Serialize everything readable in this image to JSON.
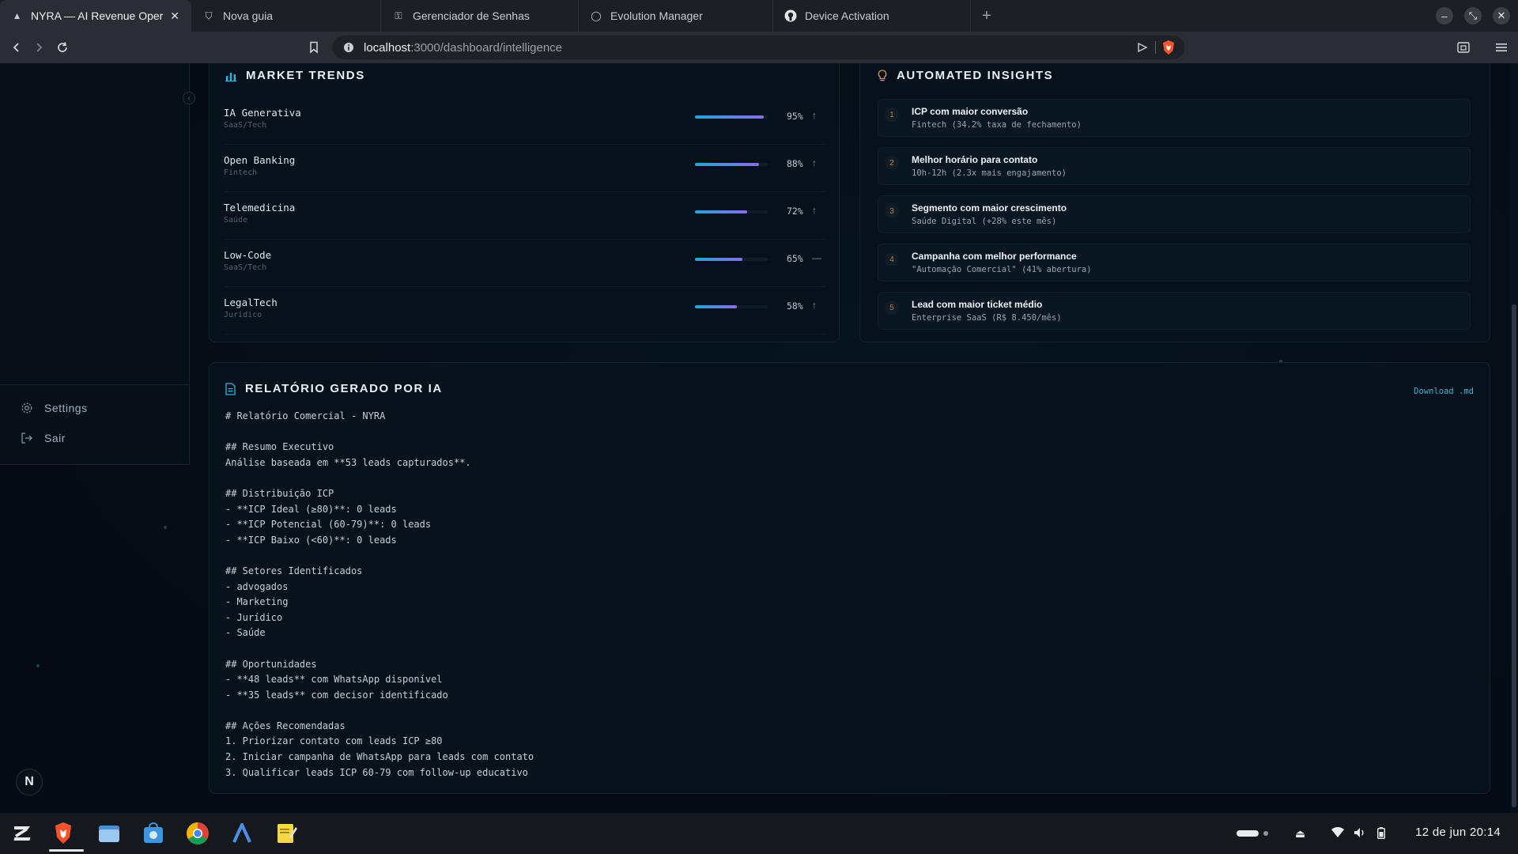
{
  "browser": {
    "tabs": [
      {
        "label": "NYRA — AI Revenue Operat",
        "icon": "nyra-logo-icon",
        "active": true
      },
      {
        "label": "Nova guia",
        "icon": "brave-shield-icon",
        "active": false
      },
      {
        "label": "Gerenciador de Senhas",
        "icon": "key-icon",
        "active": false
      },
      {
        "label": "Evolution Manager",
        "icon": "chat-bubble-icon",
        "active": false
      },
      {
        "label": "Device Activation",
        "icon": "github-icon",
        "active": false
      }
    ],
    "new_tab": "+",
    "url_host": "localhost",
    "url_path": ":3000/dashboard/intelligence",
    "window_controls": {
      "minimize": "–",
      "restore": "⤡",
      "close": "✕"
    }
  },
  "sidebar": {
    "settings_label": "Settings",
    "logout_label": "Sair",
    "avatar_letter": "N"
  },
  "market_trends": {
    "title": "MARKET TRENDS",
    "items": [
      {
        "name": "IA Generativa",
        "sector": "SaaS/Tech",
        "pct_label": "95%",
        "value": 0.95,
        "trend": "↑"
      },
      {
        "name": "Open Banking",
        "sector": "Fintech",
        "pct_label": "88%",
        "value": 0.88,
        "trend": "↑"
      },
      {
        "name": "Telemedicina",
        "sector": "Saúde",
        "pct_label": "72%",
        "value": 0.72,
        "trend": "↑"
      },
      {
        "name": "Low-Code",
        "sector": "SaaS/Tech",
        "pct_label": "65%",
        "value": 0.65,
        "trend": "—"
      },
      {
        "name": "LegalTech",
        "sector": "Jurídico",
        "pct_label": "58%",
        "value": 0.58,
        "trend": "↑"
      }
    ]
  },
  "insights": {
    "title": "AUTOMATED INSIGHTS",
    "items": [
      {
        "num": "1",
        "title": "ICP com maior conversão",
        "desc": "Fintech (34.2% taxa de fechamento)"
      },
      {
        "num": "2",
        "title": "Melhor horário para contato",
        "desc": "10h-12h (2.3x mais engajamento)"
      },
      {
        "num": "3",
        "title": "Segmento com maior crescimento",
        "desc": "Saúde Digital (+28% este mês)"
      },
      {
        "num": "4",
        "title": "Campanha com melhor performance",
        "desc": "\"Automação Comercial\" (41% abertura)"
      },
      {
        "num": "5",
        "title": "Lead com maior ticket médio",
        "desc": "Enterprise SaaS (R$ 8.450/mês)"
      }
    ]
  },
  "report": {
    "title": "RELATÓRIO GERADO POR IA",
    "download_label": "Download .md",
    "lines": [
      "# Relatório Comercial - NYRA",
      "",
      "## Resumo Executivo",
      "Análise baseada em **53 leads capturados**.",
      "",
      "## Distribuição ICP",
      "- **ICP Ideal (≥80)**: 0 leads",
      "- **ICP Potencial (60-79)**: 0 leads",
      "- **ICP Baixo (<60)**: 0 leads",
      "",
      "## Setores Identificados",
      "- advogados",
      "- Marketing",
      "- Jurídico",
      "- Saúde",
      "",
      "## Oportunidades",
      "- **48 leads** com WhatsApp disponível",
      "- **35 leads** com decisor identificado",
      "",
      "## Ações Recomendadas",
      "1. Priorizar contato com leads ICP ≥80",
      "2. Iniciar campanha de WhatsApp para leads com contato",
      "3. Qualificar leads ICP 60-79 com follow-up educativo"
    ]
  },
  "taskbar": {
    "apps": [
      "zorin-menu-icon",
      "brave-browser-icon",
      "files-icon",
      "software-store-icon",
      "chrome-icon",
      "arc-app-icon",
      "notes-icon"
    ],
    "clock": "12 de jun  20:14"
  },
  "colors": {
    "accent": "#1ea8d8",
    "accent2": "#8a6cf0",
    "background": "#050b14",
    "card": "#07111b"
  }
}
